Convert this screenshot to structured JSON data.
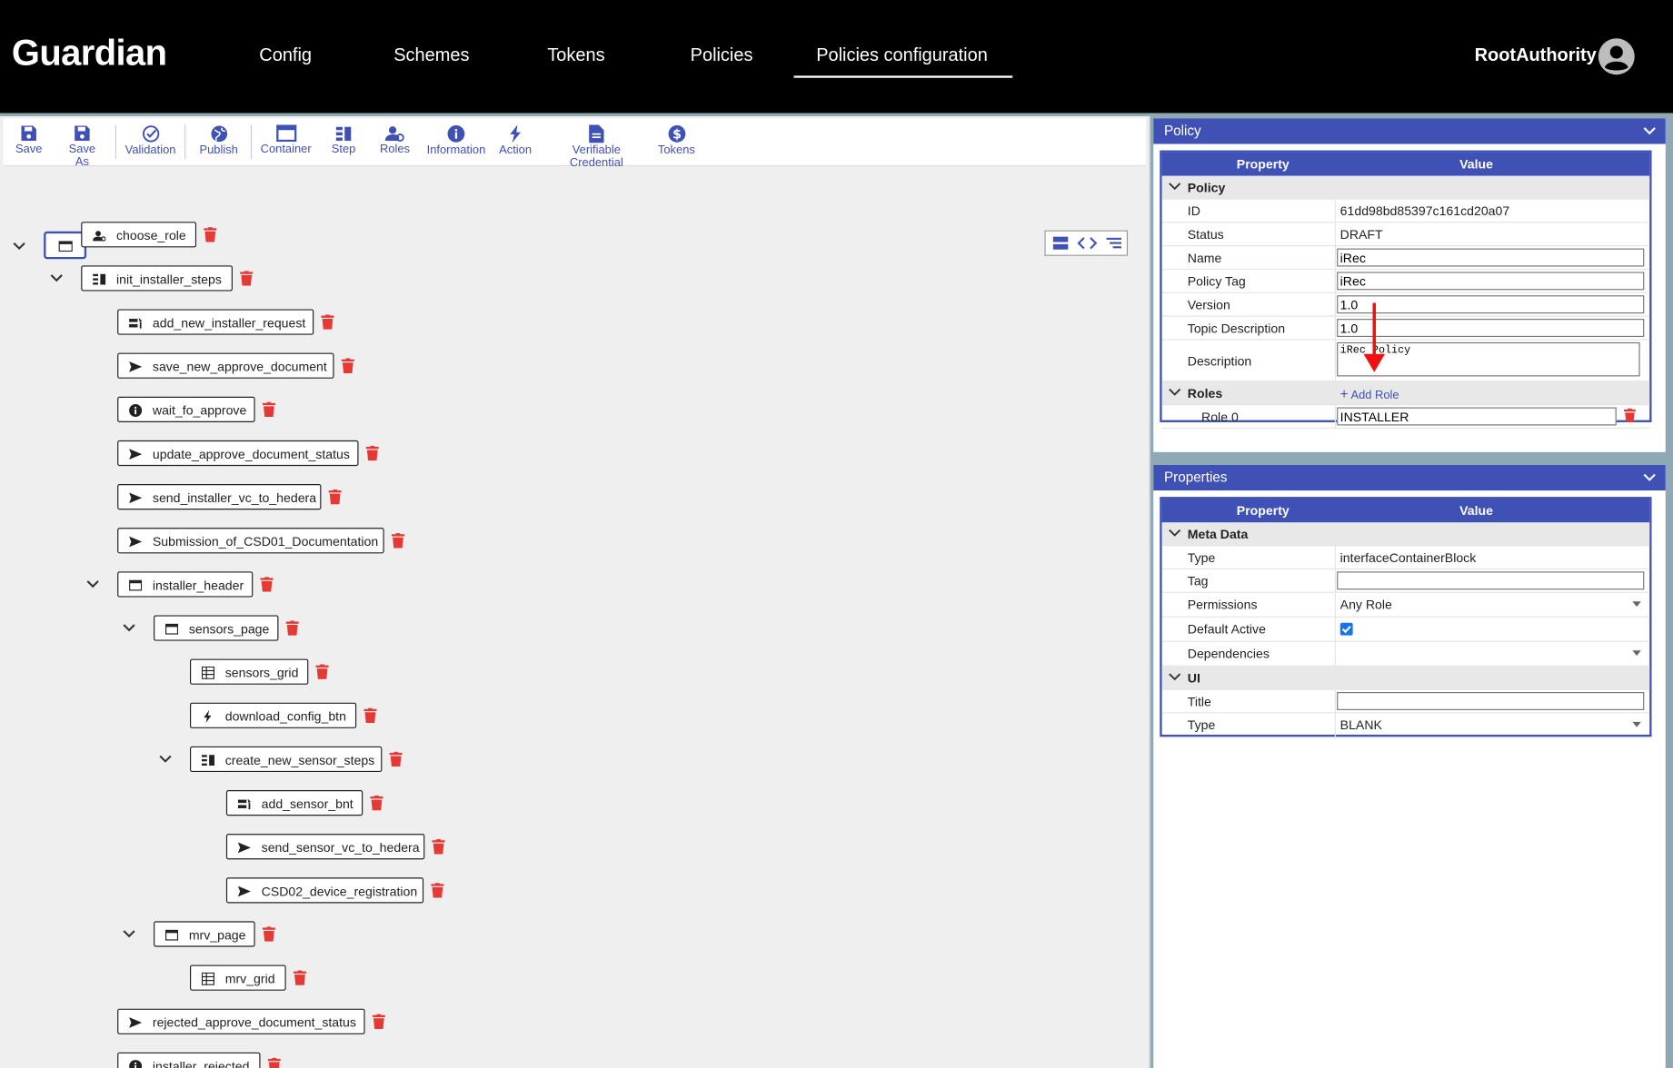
{
  "header": {
    "logo": "Guardian",
    "nav": [
      "Config",
      "Schemes",
      "Tokens",
      "Policies",
      "Policies configuration"
    ],
    "active_nav": "Policies configuration",
    "user": "RootAuthority"
  },
  "toolbar": {
    "buttons": [
      "Save",
      "Save As",
      "Validation",
      "Publish",
      "Container",
      "Step",
      "Roles",
      "Information",
      "Action",
      "Verifiable Credential",
      "Tokens"
    ]
  },
  "tree": {
    "nodes": [
      {
        "label": "choose_role",
        "icon": "roles-icon"
      },
      {
        "label": "init_installer_steps",
        "icon": "step-icon"
      },
      {
        "label": "add_new_installer_request",
        "icon": "form-icon"
      },
      {
        "label": "save_new_approve_document",
        "icon": "send-icon"
      },
      {
        "label": "wait_fo_approve",
        "icon": "info-icon"
      },
      {
        "label": "update_approve_document_status",
        "icon": "send-icon"
      },
      {
        "label": "send_installer_vc_to_hedera",
        "icon": "send-icon"
      },
      {
        "label": "Submission_of_CSD01_Documentation",
        "icon": "send-icon"
      },
      {
        "label": "installer_header",
        "icon": "container-icon"
      },
      {
        "label": "sensors_page",
        "icon": "container-icon"
      },
      {
        "label": "sensors_grid",
        "icon": "grid-icon"
      },
      {
        "label": "download_config_btn",
        "icon": "action-icon"
      },
      {
        "label": "create_new_sensor_steps",
        "icon": "step-icon"
      },
      {
        "label": "add_sensor_bnt",
        "icon": "form-icon"
      },
      {
        "label": "send_sensor_vc_to_hedera",
        "icon": "send-icon"
      },
      {
        "label": "CSD02_device_registration",
        "icon": "send-icon"
      },
      {
        "label": "mrv_page",
        "icon": "container-icon"
      },
      {
        "label": "mrv_grid",
        "icon": "grid-icon"
      },
      {
        "label": "rejected_approve_document_status",
        "icon": "send-icon"
      },
      {
        "label": "installer_rejected",
        "icon": "info-icon"
      }
    ]
  },
  "policy_panel": {
    "title": "Policy",
    "col_property": "Property",
    "col_value": "Value",
    "group_policy": "Policy",
    "rows": [
      {
        "key": "ID",
        "value": "61dd98bd85397c161cd20a07"
      },
      {
        "key": "Status",
        "value": "DRAFT"
      },
      {
        "key": "Name",
        "value": "iRec"
      },
      {
        "key": "Policy Tag",
        "value": "iRec"
      },
      {
        "key": "Version",
        "value": "1.0"
      },
      {
        "key": "Topic Description",
        "value": "1.0"
      },
      {
        "key": "Description",
        "value": "iRec Policy"
      }
    ],
    "group_roles": "Roles",
    "add_role": "Add Role",
    "role_key": "Role 0",
    "role_value": "INSTALLER"
  },
  "properties_panel": {
    "title": "Properties",
    "col_property": "Property",
    "col_value": "Value",
    "group_meta": "Meta Data",
    "type_key": "Type",
    "type_value": "interfaceContainerBlock",
    "tag_key": "Tag",
    "tag_value": "",
    "permissions_key": "Permissions",
    "permissions_value": "Any Role",
    "default_active_key": "Default Active",
    "default_active": true,
    "dependencies_key": "Dependencies",
    "dependencies_value": "",
    "group_ui": "UI",
    "title_key": "Title",
    "title_value": "",
    "ui_type_key": "Type",
    "ui_type_value": "BLANK"
  },
  "colors": {
    "accent": "#3f51b5",
    "delete": "#e53935",
    "header_bg": "#000000",
    "annotation_arrow": "#ee1111"
  }
}
